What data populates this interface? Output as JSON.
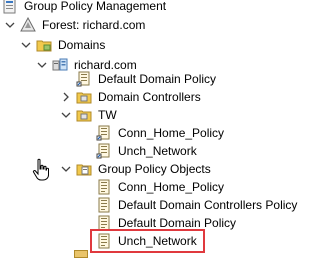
{
  "tree": {
    "root": {
      "label": "Group Policy Management",
      "icon": "gpm-console-icon"
    },
    "forest": {
      "label": "Forest: richard.com",
      "icon": "forest-icon"
    },
    "domains": {
      "label": "Domains",
      "icon": "domains-folder-icon"
    },
    "domain": {
      "label": "richard.com",
      "icon": "domain-icon"
    },
    "default_domain_policy_link": {
      "label": "Default Domain Policy",
      "icon": "gpo-link-icon"
    },
    "domain_controllers": {
      "label": "Domain Controllers",
      "icon": "ou-folder-icon"
    },
    "tw": {
      "label": "TW",
      "icon": "ou-folder-icon"
    },
    "tw_conn_home_policy": {
      "label": "Conn_Home_Policy",
      "icon": "gpo-link-icon"
    },
    "tw_unch_network": {
      "label": "Unch_Network",
      "icon": "gpo-link-icon"
    },
    "gpo_folder": {
      "label": "Group Policy Objects",
      "icon": "gpo-folder-icon"
    },
    "gpo_conn_home_policy": {
      "label": "Conn_Home_Policy",
      "icon": "gpo-icon"
    },
    "gpo_default_dc_policy": {
      "label": "Default Domain Controllers Policy",
      "icon": "gpo-icon"
    },
    "gpo_default_domain_policy": {
      "label": "Default Domain Policy",
      "icon": "gpo-icon"
    },
    "gpo_unch_network": {
      "label": "Unch_Network",
      "icon": "gpo-icon"
    }
  },
  "highlight_color": "#e0393e"
}
